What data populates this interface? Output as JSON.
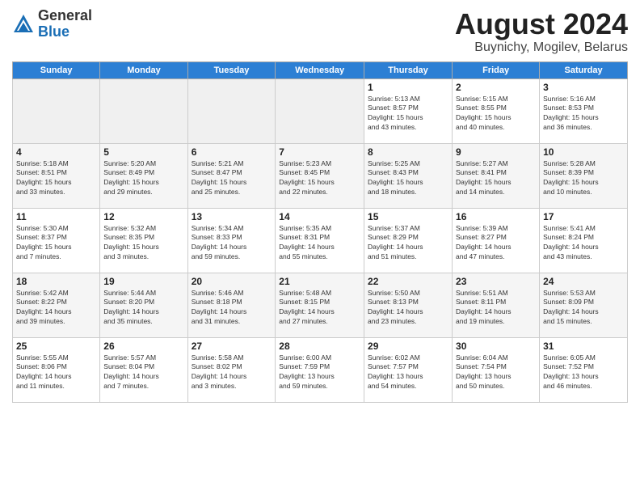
{
  "logo": {
    "general": "General",
    "blue": "Blue"
  },
  "title": "August 2024",
  "subtitle": "Buynichy, Mogilev, Belarus",
  "days_of_week": [
    "Sunday",
    "Monday",
    "Tuesday",
    "Wednesday",
    "Thursday",
    "Friday",
    "Saturday"
  ],
  "weeks": [
    [
      {
        "day": "",
        "info": ""
      },
      {
        "day": "",
        "info": ""
      },
      {
        "day": "",
        "info": ""
      },
      {
        "day": "",
        "info": ""
      },
      {
        "day": "1",
        "info": "Sunrise: 5:13 AM\nSunset: 8:57 PM\nDaylight: 15 hours\nand 43 minutes."
      },
      {
        "day": "2",
        "info": "Sunrise: 5:15 AM\nSunset: 8:55 PM\nDaylight: 15 hours\nand 40 minutes."
      },
      {
        "day": "3",
        "info": "Sunrise: 5:16 AM\nSunset: 8:53 PM\nDaylight: 15 hours\nand 36 minutes."
      }
    ],
    [
      {
        "day": "4",
        "info": "Sunrise: 5:18 AM\nSunset: 8:51 PM\nDaylight: 15 hours\nand 33 minutes."
      },
      {
        "day": "5",
        "info": "Sunrise: 5:20 AM\nSunset: 8:49 PM\nDaylight: 15 hours\nand 29 minutes."
      },
      {
        "day": "6",
        "info": "Sunrise: 5:21 AM\nSunset: 8:47 PM\nDaylight: 15 hours\nand 25 minutes."
      },
      {
        "day": "7",
        "info": "Sunrise: 5:23 AM\nSunset: 8:45 PM\nDaylight: 15 hours\nand 22 minutes."
      },
      {
        "day": "8",
        "info": "Sunrise: 5:25 AM\nSunset: 8:43 PM\nDaylight: 15 hours\nand 18 minutes."
      },
      {
        "day": "9",
        "info": "Sunrise: 5:27 AM\nSunset: 8:41 PM\nDaylight: 15 hours\nand 14 minutes."
      },
      {
        "day": "10",
        "info": "Sunrise: 5:28 AM\nSunset: 8:39 PM\nDaylight: 15 hours\nand 10 minutes."
      }
    ],
    [
      {
        "day": "11",
        "info": "Sunrise: 5:30 AM\nSunset: 8:37 PM\nDaylight: 15 hours\nand 7 minutes."
      },
      {
        "day": "12",
        "info": "Sunrise: 5:32 AM\nSunset: 8:35 PM\nDaylight: 15 hours\nand 3 minutes."
      },
      {
        "day": "13",
        "info": "Sunrise: 5:34 AM\nSunset: 8:33 PM\nDaylight: 14 hours\nand 59 minutes."
      },
      {
        "day": "14",
        "info": "Sunrise: 5:35 AM\nSunset: 8:31 PM\nDaylight: 14 hours\nand 55 minutes."
      },
      {
        "day": "15",
        "info": "Sunrise: 5:37 AM\nSunset: 8:29 PM\nDaylight: 14 hours\nand 51 minutes."
      },
      {
        "day": "16",
        "info": "Sunrise: 5:39 AM\nSunset: 8:27 PM\nDaylight: 14 hours\nand 47 minutes."
      },
      {
        "day": "17",
        "info": "Sunrise: 5:41 AM\nSunset: 8:24 PM\nDaylight: 14 hours\nand 43 minutes."
      }
    ],
    [
      {
        "day": "18",
        "info": "Sunrise: 5:42 AM\nSunset: 8:22 PM\nDaylight: 14 hours\nand 39 minutes."
      },
      {
        "day": "19",
        "info": "Sunrise: 5:44 AM\nSunset: 8:20 PM\nDaylight: 14 hours\nand 35 minutes."
      },
      {
        "day": "20",
        "info": "Sunrise: 5:46 AM\nSunset: 8:18 PM\nDaylight: 14 hours\nand 31 minutes."
      },
      {
        "day": "21",
        "info": "Sunrise: 5:48 AM\nSunset: 8:15 PM\nDaylight: 14 hours\nand 27 minutes."
      },
      {
        "day": "22",
        "info": "Sunrise: 5:50 AM\nSunset: 8:13 PM\nDaylight: 14 hours\nand 23 minutes."
      },
      {
        "day": "23",
        "info": "Sunrise: 5:51 AM\nSunset: 8:11 PM\nDaylight: 14 hours\nand 19 minutes."
      },
      {
        "day": "24",
        "info": "Sunrise: 5:53 AM\nSunset: 8:09 PM\nDaylight: 14 hours\nand 15 minutes."
      }
    ],
    [
      {
        "day": "25",
        "info": "Sunrise: 5:55 AM\nSunset: 8:06 PM\nDaylight: 14 hours\nand 11 minutes."
      },
      {
        "day": "26",
        "info": "Sunrise: 5:57 AM\nSunset: 8:04 PM\nDaylight: 14 hours\nand 7 minutes."
      },
      {
        "day": "27",
        "info": "Sunrise: 5:58 AM\nSunset: 8:02 PM\nDaylight: 14 hours\nand 3 minutes."
      },
      {
        "day": "28",
        "info": "Sunrise: 6:00 AM\nSunset: 7:59 PM\nDaylight: 13 hours\nand 59 minutes."
      },
      {
        "day": "29",
        "info": "Sunrise: 6:02 AM\nSunset: 7:57 PM\nDaylight: 13 hours\nand 54 minutes."
      },
      {
        "day": "30",
        "info": "Sunrise: 6:04 AM\nSunset: 7:54 PM\nDaylight: 13 hours\nand 50 minutes."
      },
      {
        "day": "31",
        "info": "Sunrise: 6:05 AM\nSunset: 7:52 PM\nDaylight: 13 hours\nand 46 minutes."
      }
    ]
  ]
}
